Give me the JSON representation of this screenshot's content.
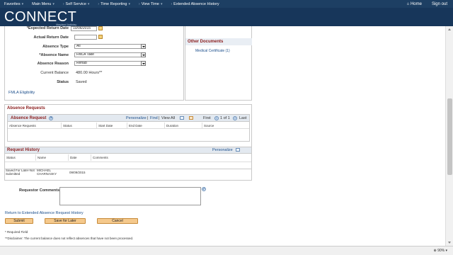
{
  "topnav": {
    "items": [
      {
        "label": "Favorites"
      },
      {
        "label": "Main Menu"
      },
      {
        "label": "Self Service"
      },
      {
        "label": "Time Reporting"
      },
      {
        "label": "View Time"
      }
    ],
    "current": "Extended Absence History",
    "home": "Home",
    "signout": "Sign out"
  },
  "brand": {
    "title": "CONNECT",
    "subtitle": "Maryland Judiciary"
  },
  "form": {
    "expected_return_label": "*Expected Return Date",
    "expected_return_value": "10/06/2015",
    "actual_return_label": "Actual Return Date",
    "actual_return_value": "",
    "absence_type_label": "Absence Type",
    "absence_type_value": "All",
    "absence_name_label": "*Absence Name",
    "absence_name_value": "FMLA Take",
    "absence_reason_label": "Absence Reason",
    "absence_reason_value": "Rehab",
    "current_balance_label": "Current Balance",
    "current_balance_value": "480.00 Hours**",
    "status_label": "Status",
    "status_value": "Saved",
    "fmla_link": "FMLA Eligibility"
  },
  "other_documents": {
    "title": "Other Documents",
    "link": "Medical Certificate (1)"
  },
  "absence_requests": {
    "section_title": "Absence Requests",
    "grid_title": "Absence Request",
    "personalize": "Personalize",
    "find": "Find",
    "view_all": "View All",
    "first": "First",
    "range": "1 of 1",
    "last": "Last",
    "columns": [
      "Absence Requests",
      "Status",
      "Start Date",
      "End Date",
      "Duration",
      "Source"
    ]
  },
  "request_history": {
    "title": "Request History",
    "personalize": "Personalize",
    "columns": [
      "Status",
      "Name",
      "Date",
      "Comments"
    ],
    "rows": [
      {
        "status": "Saved For Later-Not Submitted",
        "name": "MICHAEL CHARNASKY",
        "date": "09/09/2015",
        "comments": ""
      }
    ]
  },
  "requestor_comments_label": "Requestor Comments",
  "return_link": "Return to Extended Absence Request History",
  "buttons": {
    "submit": "Submit",
    "save_later": "Save for Later",
    "cancel": "Cancel"
  },
  "notes": {
    "required": "* Required Field",
    "disclaimer": "**Disclaimer: The current balance does not reflect absences that have not been processed."
  },
  "statusbar": {
    "zoom": "90%"
  },
  "colors": {
    "topbar": "#1d3f63",
    "brandbar": "#17365a",
    "section_title": "#8a1c1c",
    "link": "#1c4f8c",
    "button": "#f5c98c"
  }
}
